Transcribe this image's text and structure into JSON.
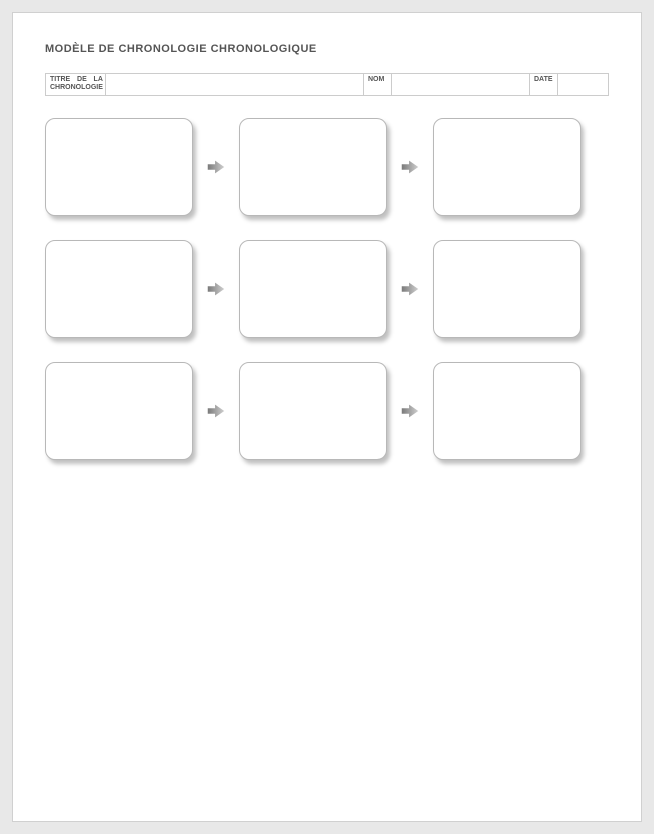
{
  "title": "MODÈLE DE CHRONOLOGIE CHRONOLOGIQUE",
  "header": {
    "chronology_title_label": "TITRE DE LA CHRONOLOGIE",
    "chronology_title_value": "",
    "name_label": "NOM",
    "name_value": "",
    "date_label": "DATE",
    "date_value": ""
  },
  "cards": [
    [
      "",
      "",
      ""
    ],
    [
      "",
      "",
      ""
    ],
    [
      "",
      "",
      ""
    ]
  ]
}
